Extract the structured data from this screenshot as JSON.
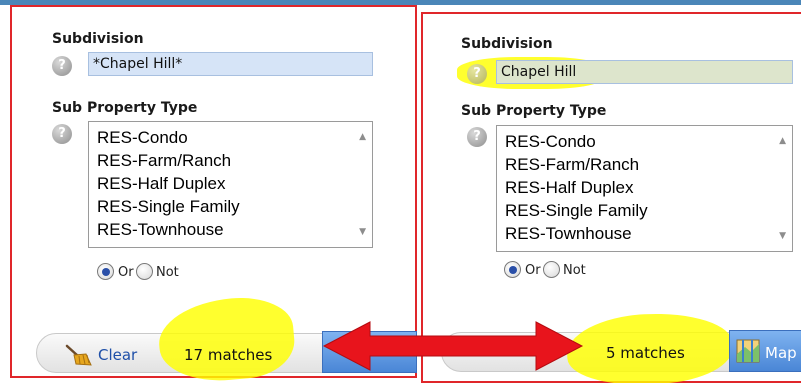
{
  "left_panel": {
    "subdivision_label": "Subdivision",
    "subdivision_value": "*Chapel Hill*",
    "sub_property_type_label": "Sub Property Type",
    "property_types": [
      "RES-Condo",
      "RES-Farm/Ranch",
      "RES-Half Duplex",
      "RES-Single Family",
      "RES-Townhouse"
    ],
    "radio_or": "Or",
    "radio_not": "Not",
    "clear_label": "Clear",
    "matches": "17 matches"
  },
  "right_panel": {
    "subdivision_label": "Subdivision",
    "subdivision_value": "Chapel Hill",
    "sub_property_type_label": "Sub Property Type",
    "property_types": [
      "RES-Condo",
      "RES-Farm/Ranch",
      "RES-Half Duplex",
      "RES-Single Family",
      "RES-Townhouse"
    ],
    "radio_or": "Or",
    "radio_not": "Not",
    "matches": "5 matches",
    "map_label": "Map"
  },
  "icons": {
    "help": "question-circle-icon",
    "clear": "broom-icon",
    "map": "map-icon",
    "annotation": "double-arrow-icon"
  },
  "colors": {
    "panel_border": "#e0262a",
    "highlight": "#ffff00",
    "input_background": "#d6e4f7",
    "arrow": "#e8141c",
    "map_button": "#4a86d6"
  }
}
